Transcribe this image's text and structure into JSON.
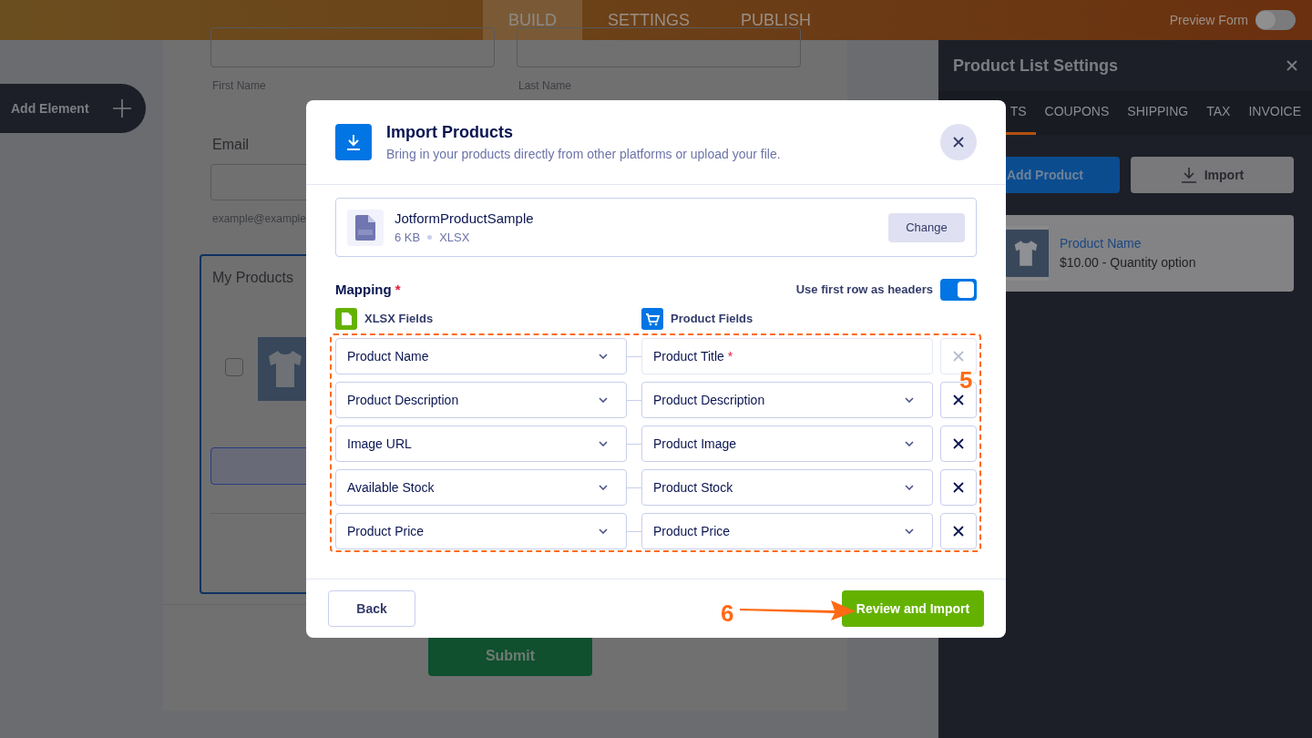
{
  "top_bar": {
    "tabs": [
      {
        "label": "BUILD",
        "selected": true
      },
      {
        "label": "SETTINGS",
        "selected": false
      },
      {
        "label": "PUBLISH",
        "selected": false
      }
    ],
    "preview_form": {
      "label": "Preview Form",
      "on": false
    }
  },
  "sidebar": {
    "add_element": "Add Element"
  },
  "form": {
    "first_name_label": "First Name",
    "last_name_label": "Last Name",
    "email_label": "Email",
    "email_hint": "example@example",
    "products_title": "My Products",
    "product_checked": false,
    "submit": "Submit"
  },
  "right_panel": {
    "title": "Product List Settings",
    "tabs": [
      {
        "label": "TS",
        "selected": true
      },
      {
        "label": "COUPONS",
        "selected": false
      },
      {
        "label": "SHIPPING",
        "selected": false
      },
      {
        "label": "TAX",
        "selected": false
      },
      {
        "label": "INVOICE",
        "selected": false
      }
    ],
    "add_product": "Add Product",
    "import": "Import",
    "product": {
      "name": "Product Name",
      "detail": "$10.00 - Quantity option"
    }
  },
  "modal": {
    "title": "Import Products",
    "subtitle": "Bring in your products directly from other platforms or upload your file.",
    "file": {
      "name": "JotformProductSample",
      "size": "6 KB",
      "type": "XLSX",
      "change": "Change"
    },
    "mapping": {
      "label": "Mapping",
      "required_mark": "*"
    },
    "headers_toggle": {
      "label": "Use first row as headers",
      "on": true
    },
    "source_header": "XLSX Fields",
    "target_header": "Product Fields",
    "rows": [
      {
        "kind": "fixed",
        "source": "Product Name",
        "target": "Product Title",
        "required_mark": "*",
        "removable": false
      },
      {
        "kind": "select",
        "source": "Product Description",
        "target": "Product Description",
        "removable": true
      },
      {
        "kind": "select",
        "source": "Image URL",
        "target": "Product Image",
        "removable": true
      },
      {
        "kind": "select",
        "source": "Available Stock",
        "target": "Product Stock",
        "removable": true
      },
      {
        "kind": "select",
        "source": "Product Price",
        "target": "Product Price",
        "removable": true
      }
    ],
    "back": "Back",
    "review": "Review and Import"
  },
  "annotations": [
    {
      "label": "5"
    },
    {
      "label": "6"
    }
  ]
}
